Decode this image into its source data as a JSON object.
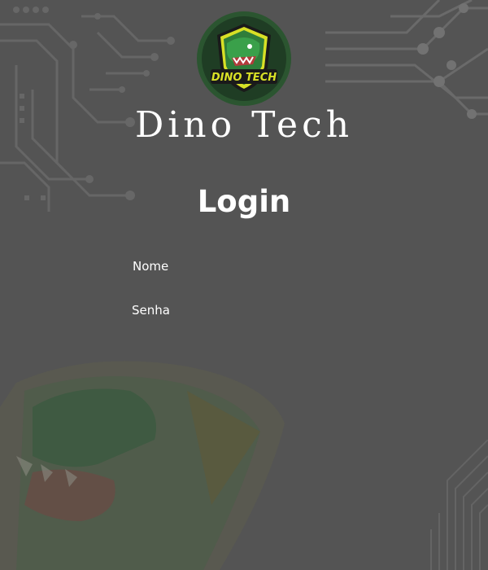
{
  "app": {
    "brand_name": "Dino Tech",
    "logo_text": "DINO TECH"
  },
  "login": {
    "title": "Login",
    "fields": [
      {
        "label": "Nome"
      },
      {
        "label": "Senha"
      }
    ]
  },
  "theme": {
    "background": "#545454",
    "text": "#ffffff",
    "accent_green": "#2f7d3a",
    "accent_yellow": "#d8e026"
  },
  "icons": {
    "logo": "dino-tech-logo",
    "background_art": "circuit-pattern",
    "watermark": "dinosaur-watermark"
  }
}
